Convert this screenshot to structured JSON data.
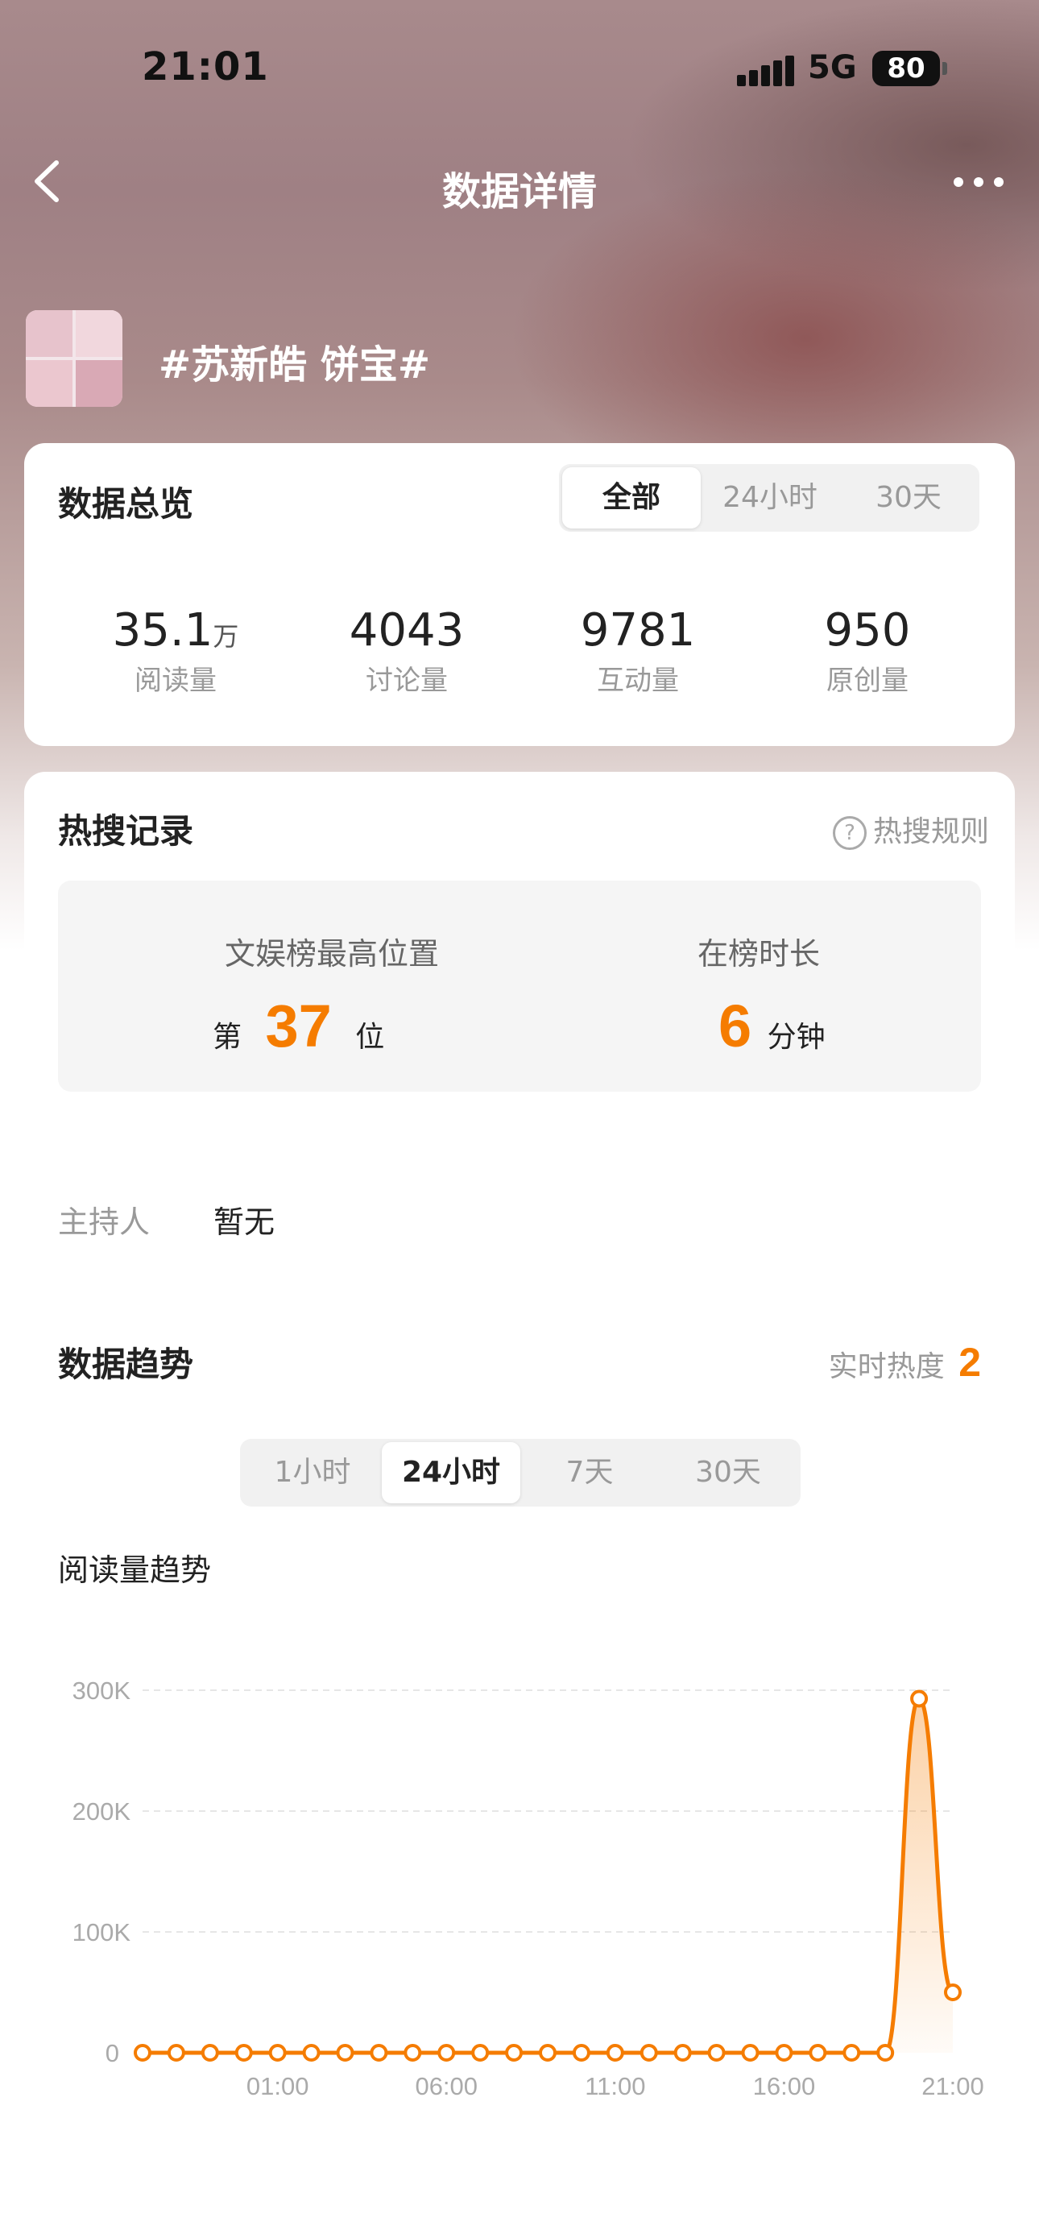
{
  "status_bar": {
    "time": "21:01",
    "network": "5G",
    "battery": "80"
  },
  "nav": {
    "title": "数据详情"
  },
  "topic": {
    "title": "#苏新皓 饼宝#"
  },
  "overview": {
    "title": "数据总览",
    "tabs": [
      "全部",
      "24小时",
      "30天"
    ],
    "active_tab": "全部",
    "stats": [
      {
        "value": "35.1",
        "unit": "万",
        "label": "阅读量"
      },
      {
        "value": "4043",
        "unit": "",
        "label": "讨论量"
      },
      {
        "value": "9781",
        "unit": "",
        "label": "互动量"
      },
      {
        "value": "950",
        "unit": "",
        "label": "原创量"
      }
    ]
  },
  "hot_search": {
    "title": "热搜记录",
    "rule_label": "热搜规则",
    "highest_label": "文娱榜最高位置",
    "highest_prefix": "第",
    "highest_value": "37",
    "highest_suffix": "位",
    "duration_label": "在榜时长",
    "duration_value": "6",
    "duration_unit": "分钟"
  },
  "host": {
    "label": "主持人",
    "value": "暂无"
  },
  "trend": {
    "title": "数据趋势",
    "realtime_label": "实时热度",
    "realtime_value": "2",
    "tabs": [
      "1小时",
      "24小时",
      "7天",
      "30天"
    ],
    "active_tab": "24小时",
    "chart_title": "阅读量趋势"
  },
  "colors": {
    "accent": "#f57c00",
    "card": "#ffffff"
  },
  "chart_data": {
    "type": "area",
    "title": "阅读量趋势",
    "xlabel": "",
    "ylabel": "",
    "x_tick_labels": [
      "01:00",
      "06:00",
      "11:00",
      "16:00",
      "21:00"
    ],
    "y_tick_labels": [
      "0",
      "100K",
      "200K",
      "300K"
    ],
    "ylim": [
      0,
      300000
    ],
    "grid": true,
    "series": [
      {
        "x": [
          "-1:00",
          "22:00",
          "23:00",
          "00:00",
          "01:00",
          "02:00",
          "03:00",
          "04:00",
          "05:00",
          "06:00",
          "07:00",
          "08:00",
          "09:00",
          "10:00",
          "11:00",
          "12:00",
          "13:00",
          "14:00",
          "15:00",
          "16:00",
          "17:00",
          "18:00",
          "19:00",
          "20:00",
          "21:00"
        ],
        "values": [
          0,
          0,
          0,
          0,
          0,
          0,
          0,
          0,
          0,
          0,
          0,
          0,
          0,
          0,
          0,
          0,
          0,
          0,
          0,
          0,
          0,
          0,
          0,
          293000,
          50000
        ]
      }
    ]
  }
}
